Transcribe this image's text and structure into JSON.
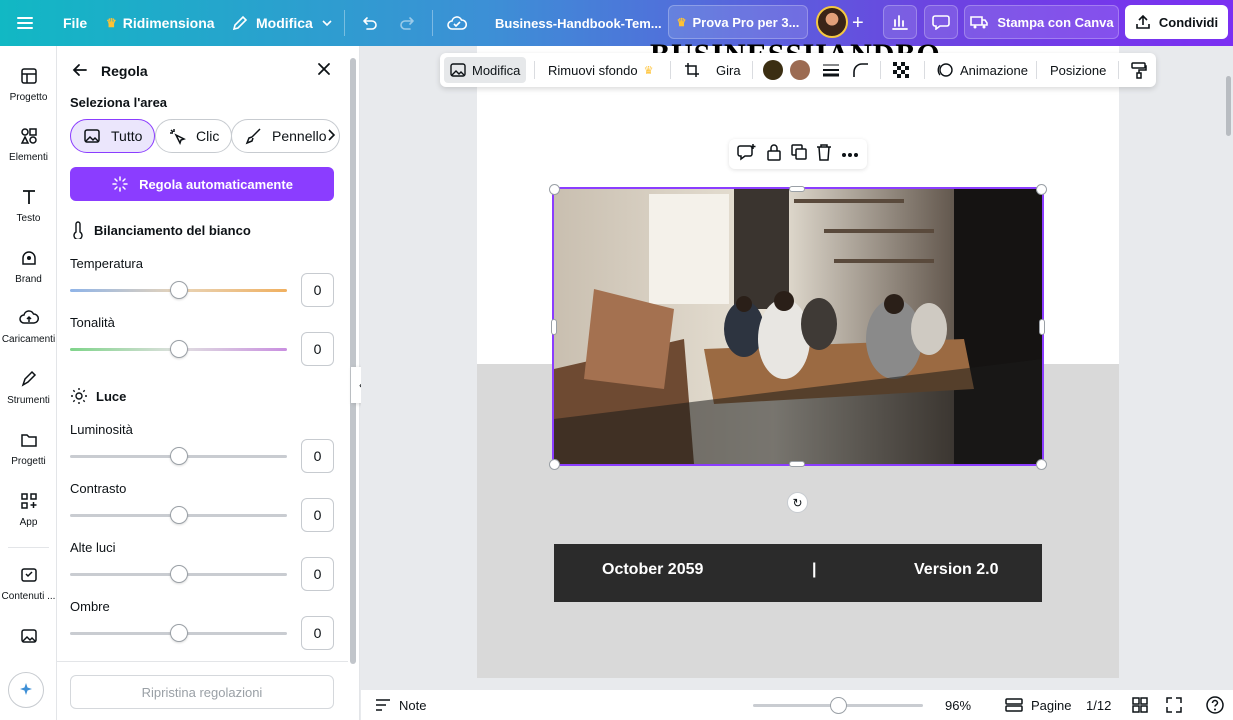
{
  "topbar": {
    "file": "File",
    "resize": "Ridimensiona",
    "edit_mode": "Modifica",
    "doc_title": "Business-Handbook-Tem...",
    "try_pro": "Prova Pro per 3...",
    "print": "Stampa con Canva",
    "share": "Condividi"
  },
  "rail": {
    "items": [
      {
        "label": "Progetto",
        "icon": "layout-icon"
      },
      {
        "label": "Elementi",
        "icon": "shapes-icon"
      },
      {
        "label": "Testo",
        "icon": "text-icon"
      },
      {
        "label": "Brand",
        "icon": "brand-icon"
      },
      {
        "label": "Caricamenti",
        "icon": "upload-icon"
      },
      {
        "label": "Strumenti",
        "icon": "pen-icon"
      },
      {
        "label": "Progetti",
        "icon": "folder-icon"
      },
      {
        "label": "App",
        "icon": "apps-icon"
      },
      {
        "label": "Contenuti ...",
        "icon": "magic-media-icon"
      },
      {
        "label": "",
        "icon": "photos-icon"
      }
    ]
  },
  "panel": {
    "title": "Regola",
    "select_area": "Seleziona l'area",
    "modes": [
      "Tutto",
      "Clic",
      "Pennello"
    ],
    "auto_adjust": "Regola automaticamente",
    "white_balance": "Bilanciamento del bianco",
    "temperature": {
      "label": "Temperatura",
      "value": "0",
      "level": 0.5
    },
    "tint": {
      "label": "Tonalità",
      "value": "0",
      "level": 0.5
    },
    "light": "Luce",
    "brightness": {
      "label": "Luminosità",
      "value": "0",
      "level": 0.5
    },
    "contrast": {
      "label": "Contrasto",
      "value": "0",
      "level": 0.5
    },
    "highlights": {
      "label": "Alte luci",
      "value": "0",
      "level": 0.5
    },
    "shadows": {
      "label": "Ombre",
      "value": "0",
      "level": 0.5
    },
    "reset": "Ripristina regolazioni"
  },
  "toolbar2": {
    "edit": "Modifica",
    "remove_bg": "Rimuovi sfondo",
    "flip": "Gira",
    "animate": "Animazione",
    "position": "Posizione",
    "color1": "#3b2e12",
    "color2": "#9c6b52"
  },
  "canvas": {
    "title": "BUSINESSHANDBOOK",
    "date": "October 2059",
    "separator": "|",
    "version": "Version 2.0"
  },
  "bottombar": {
    "notes": "Note",
    "zoom": "96%",
    "zoom_level": 0.5,
    "pages": "Pagine",
    "page_count": "1/12"
  },
  "colors": {
    "accent": "#8b3dff",
    "brand_gradient_start": "#11b8c4",
    "brand_gradient_end": "#7b2ff2"
  }
}
